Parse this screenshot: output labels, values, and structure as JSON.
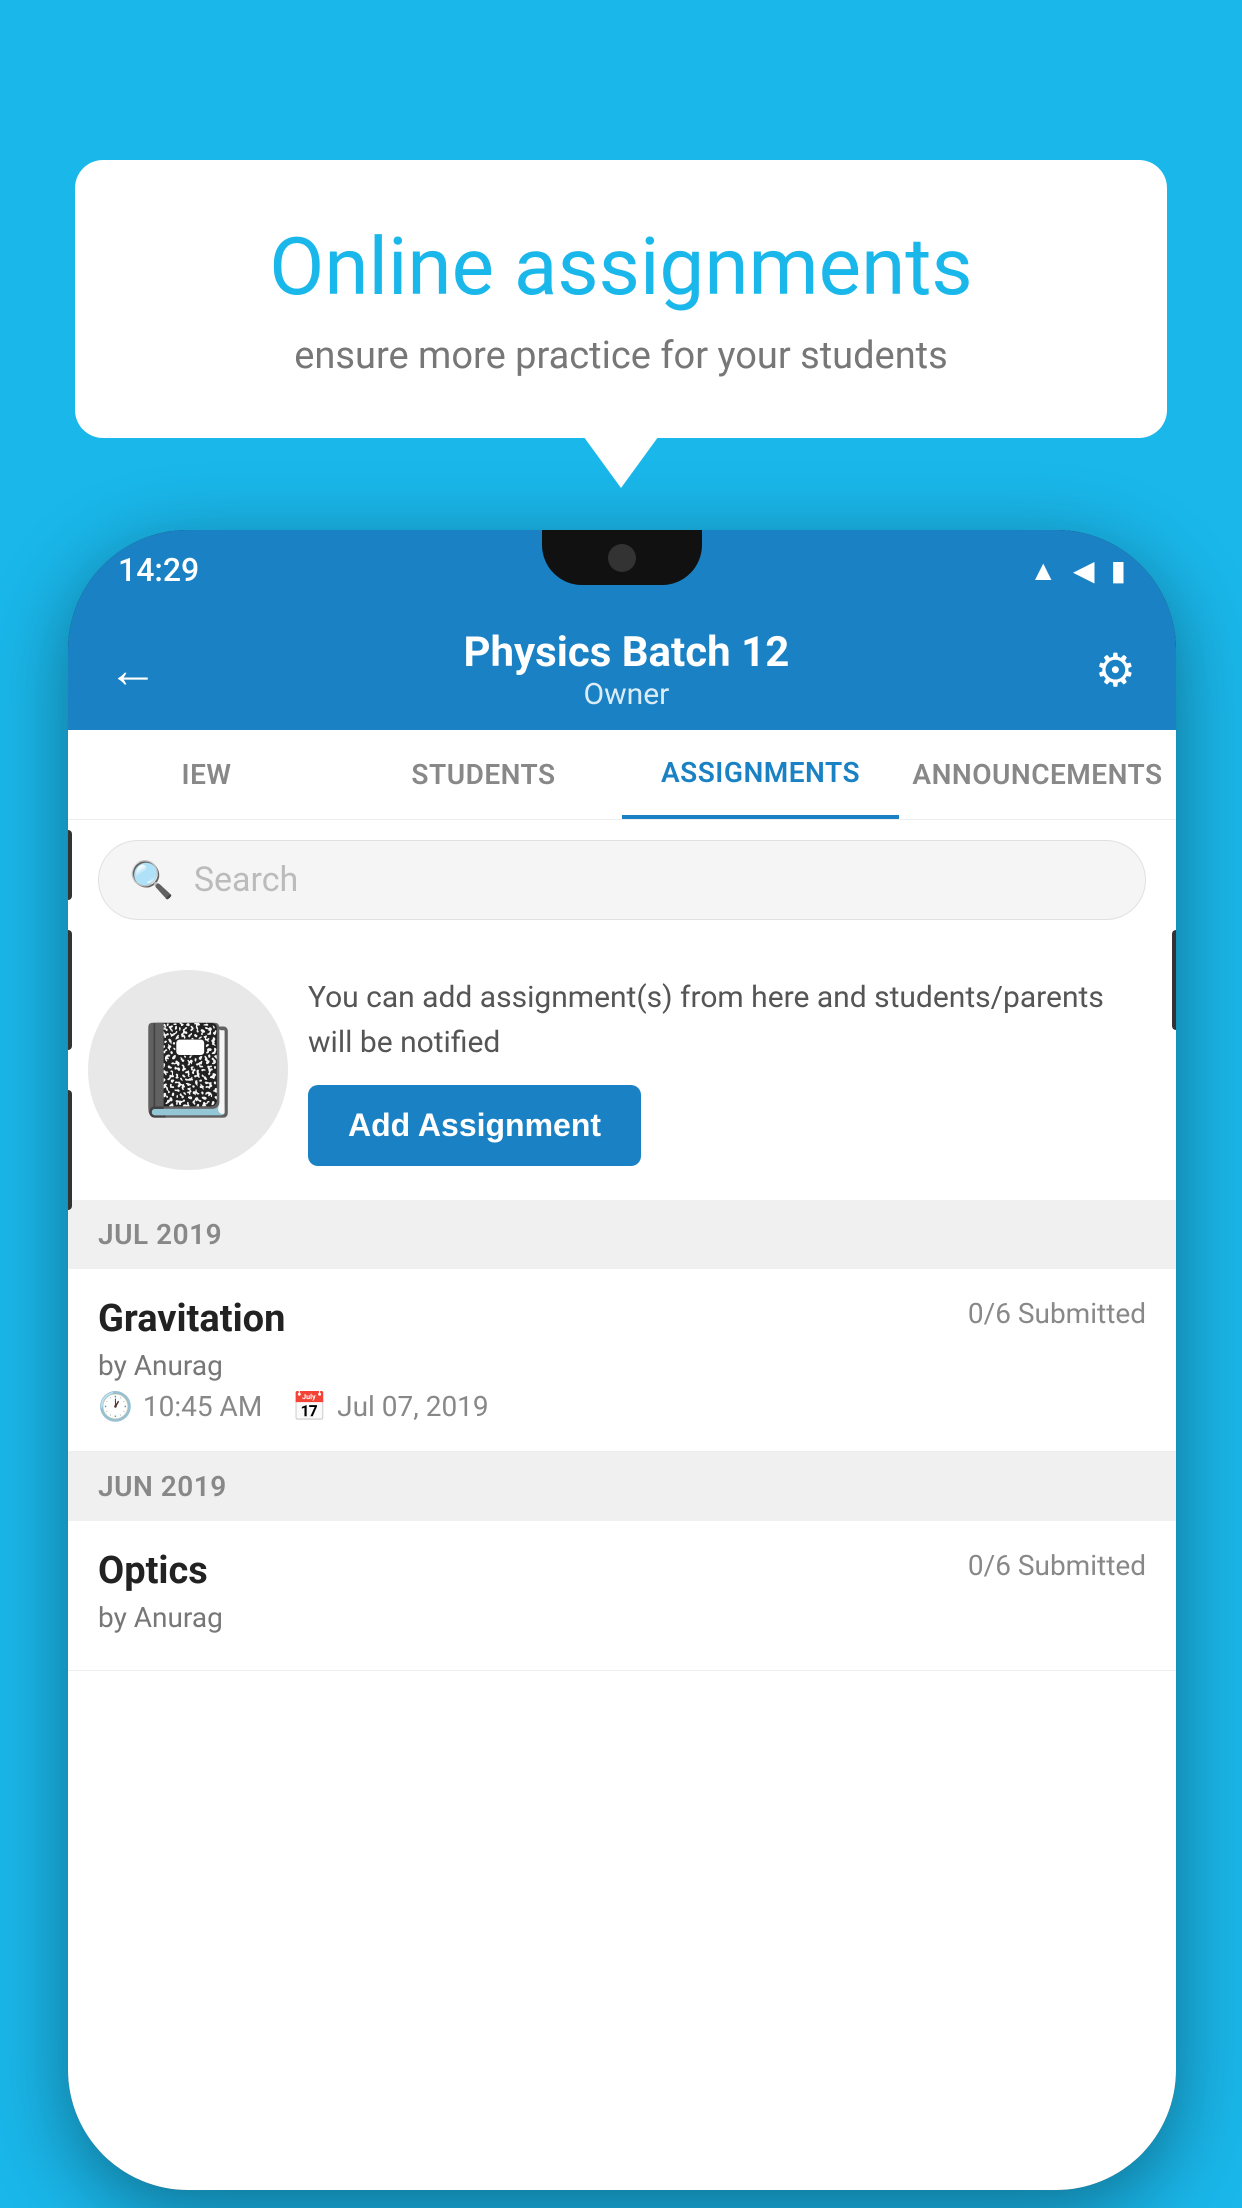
{
  "background_color": "#1ab7ea",
  "speech_bubble": {
    "title": "Online assignments",
    "subtitle": "ensure more practice for your students"
  },
  "phone": {
    "status_bar": {
      "time": "14:29",
      "icons": [
        "wifi",
        "signal",
        "battery"
      ]
    },
    "header": {
      "back_label": "←",
      "title": "Physics Batch 12",
      "subtitle": "Owner",
      "settings_label": "⚙"
    },
    "tabs": [
      {
        "label": "IEW",
        "active": false
      },
      {
        "label": "STUDENTS",
        "active": false
      },
      {
        "label": "ASSIGNMENTS",
        "active": true
      },
      {
        "label": "ANNOUNCEMENTS",
        "active": false
      }
    ],
    "search": {
      "placeholder": "Search"
    },
    "promo": {
      "text": "You can add assignment(s) from here and students/parents will be notified",
      "button_label": "Add Assignment"
    },
    "sections": [
      {
        "header": "JUL 2019",
        "assignments": [
          {
            "title": "Gravitation",
            "status": "0/6 Submitted",
            "author": "by Anurag",
            "time": "10:45 AM",
            "date": "Jul 07, 2019"
          }
        ]
      },
      {
        "header": "JUN 2019",
        "assignments": [
          {
            "title": "Optics",
            "status": "0/6 Submitted",
            "author": "by Anurag",
            "time": "",
            "date": ""
          }
        ]
      }
    ]
  }
}
